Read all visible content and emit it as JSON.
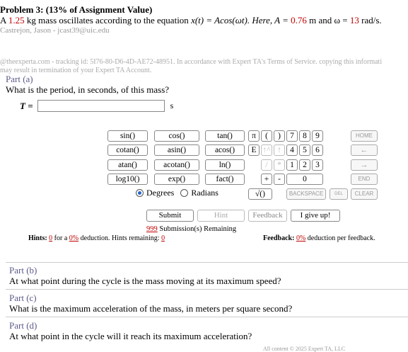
{
  "problem": {
    "title": "Problem 3: (13% of Assignment Value)",
    "text_pre_mass": "A ",
    "mass": "1.25",
    "text_after_mass": " kg mass oscillates according to the equation ",
    "equation": "x(t) = Acos(ωt). Here, A = ",
    "amplitude": "0.76",
    "text_between": " m and ω = ",
    "omega": "13",
    "text_end": " rad/s.",
    "author": "Castrejon, Jason - jcast39@uic.edu"
  },
  "tracking": {
    "line1": "@theexperta.com - tracking id: 5I76-80-D6-4D-AE72-48951. In accordance with Expert TA's Terms of Service. copying this informati",
    "line2": "may result in termination of your Expert TA Account."
  },
  "part_a": {
    "label": "Part (a)",
    "question": "What is the period, in seconds, of this mass?",
    "answer_label": "T =",
    "answer_value": "",
    "unit": "s"
  },
  "calc": {
    "functions": [
      "sin()",
      "cos()",
      "tan()",
      "cotan()",
      "asin()",
      "acos()",
      "atan()",
      "acotan()",
      "ln()",
      "log10()",
      "exp()",
      "fact()"
    ],
    "keys": {
      "pi": "π",
      "lparen": "(",
      "rparen": ")",
      "e": "E",
      "up": "↑^",
      "upr": "↑",
      "div": "/",
      "mul": "*",
      "plus": "+",
      "minus": "-",
      "sqrt": "√()",
      "n7": "7",
      "n8": "8",
      "n9": "9",
      "n4": "4",
      "n5": "5",
      "n6": "6",
      "n1": "1",
      "n2": "2",
      "n3": "3",
      "n0": "0",
      "dot": "."
    },
    "side": {
      "home": "HOME",
      "left": "←",
      "right": "→",
      "end": "END",
      "backspace": "BACKSPACE",
      "del": "DEL",
      "clear": "CLEAR"
    },
    "angle_options": [
      "Degrees",
      "Radians"
    ],
    "selected_angle": "Degrees"
  },
  "actions": {
    "submit": "Submit",
    "hint": "Hint",
    "feedback": "Feedback",
    "give_up": "I give up!",
    "submissions_num": "999",
    "submissions_text": " Submission(s) Remaining"
  },
  "hints": {
    "label": "Hints:",
    "count": "0",
    "for_a": " for a ",
    "pct": "0%",
    "deduction": " deduction. Hints remaining: ",
    "remaining": "0"
  },
  "feedback": {
    "label": "Feedback:",
    "pct": "0%",
    "text": " deduction per feedback."
  },
  "parts": [
    {
      "label": "Part (b)",
      "question": "At what point during the cycle is the mass moving at its maximum speed?"
    },
    {
      "label": "Part (c)",
      "question": "What is the maximum acceleration of the mass, in meters per square second?"
    },
    {
      "label": "Part (d)",
      "question": "At what point in the cycle will it reach its maximum acceleration?"
    }
  ],
  "footer": "All content © 2025 Expert TA, LLC"
}
